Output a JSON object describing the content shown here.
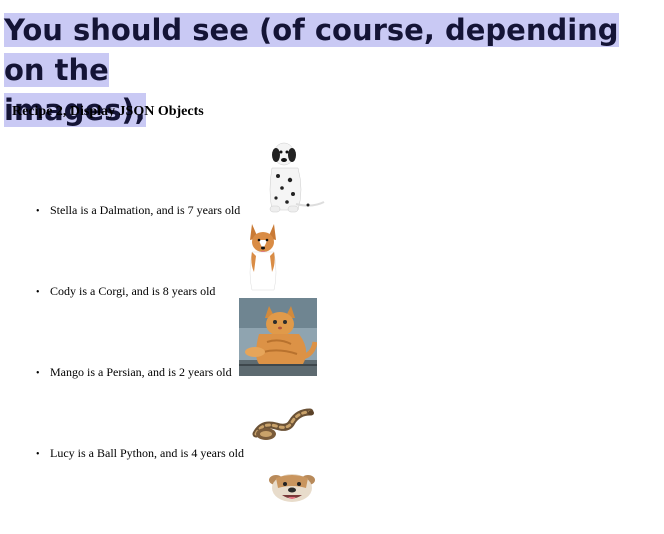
{
  "banner": {
    "line1": "You should see (of course, depending on the",
    "line2": "images),"
  },
  "recipe_title": "Recipe 2, Display JSON Objects",
  "pets": [
    {
      "text": "Stella is a Dalmation, and is 7 years old",
      "image": "dalmatian-image"
    },
    {
      "text": "Cody is a Corgi, and is 8 years old",
      "image": "corgi-image"
    },
    {
      "text": "Mango is a Persian, and is 2 years old",
      "image": "cat-image"
    },
    {
      "text": "Lucy is a Ball Python, and is 4 years old",
      "image": "python-image"
    }
  ],
  "extra_image": "bulldog-image"
}
